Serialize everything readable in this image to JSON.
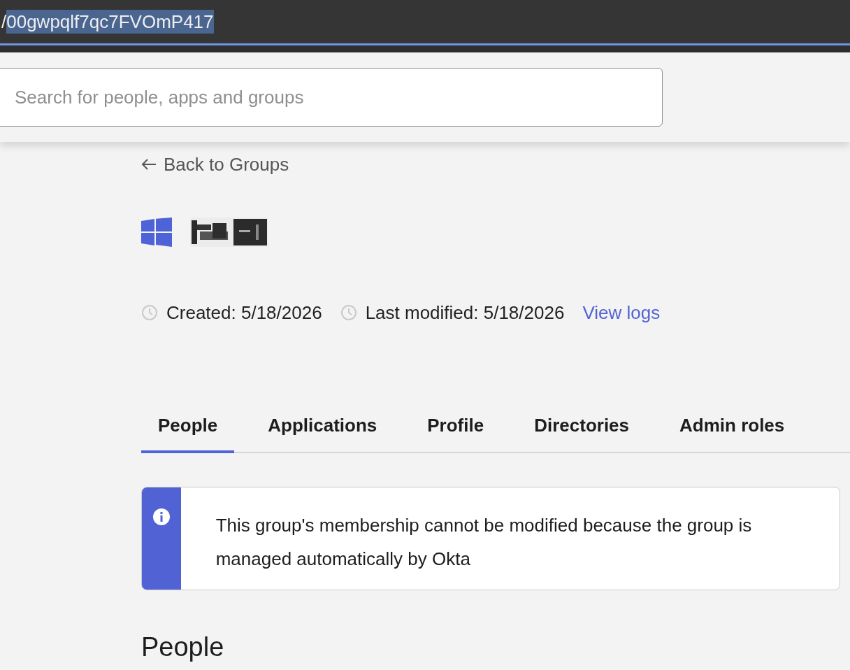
{
  "address_bar": {
    "prefix": "/",
    "selected_text": "00gwpqlf7qc7FVOmP417"
  },
  "search": {
    "placeholder": "Search for people, apps and groups"
  },
  "back_link": "Back to Groups",
  "group": {
    "icons": [
      {
        "kind": "windows-logo"
      },
      {
        "kind": "picture"
      }
    ]
  },
  "meta": {
    "created": "Created: 5/18/2026",
    "modified": "Last modified: 5/18/2026",
    "logs_link": "View logs"
  },
  "tabs": [
    {
      "label": "People",
      "selected": true
    },
    {
      "label": "Applications",
      "selected": false
    },
    {
      "label": "Profile",
      "selected": false
    },
    {
      "label": "Directories",
      "selected": false
    },
    {
      "label": "Admin roles",
      "selected": false
    }
  ],
  "notice": {
    "kind": "info",
    "text": "This group's membership cannot be modified because the group is managed automatically by Okta"
  },
  "section_title": "People"
}
